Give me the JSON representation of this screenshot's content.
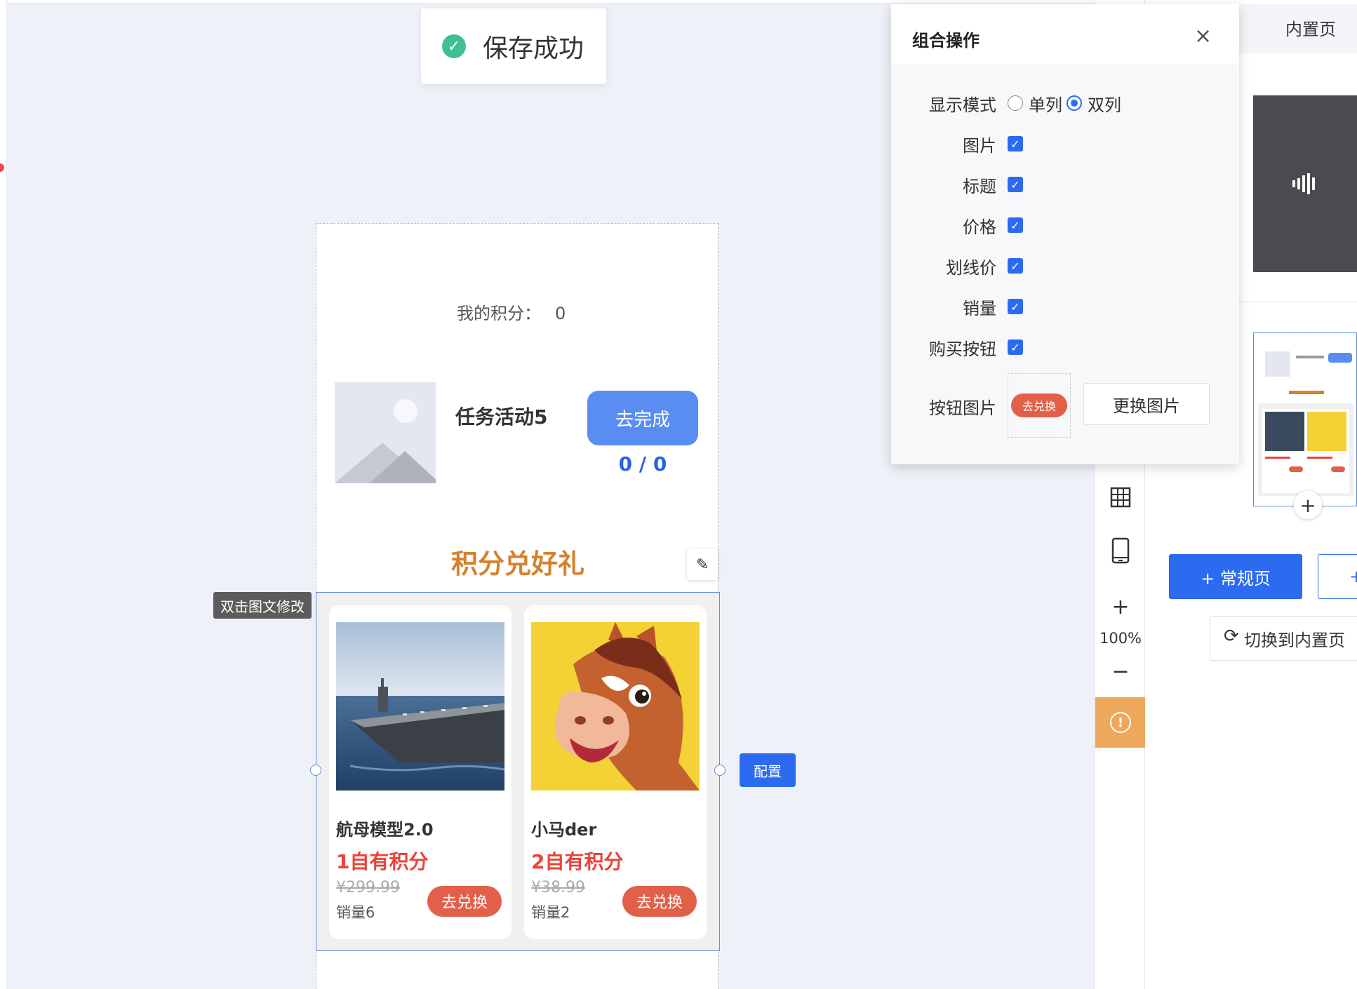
{
  "toast": {
    "icon": "check-circle-icon",
    "message": "保存成功"
  },
  "phone": {
    "points_label": "我的积分：",
    "points_value": "0",
    "task": {
      "title": "任务活动5",
      "button": "去完成",
      "progress": "0 / 0"
    },
    "section_title": "积分兑好礼",
    "hint": "双击图文修改",
    "products": [
      {
        "name": "航母模型2.0",
        "price": "1自有积分",
        "original_price": "¥299.99",
        "sales": "销量6",
        "button": "去兑换"
      },
      {
        "name": "小马der",
        "price": "2自有积分",
        "original_price": "¥38.99",
        "sales": "销量2",
        "button": "去兑换"
      }
    ]
  },
  "config_button": "配置",
  "toolbar": {
    "zoom": "100%",
    "plus": "+",
    "minus": "−"
  },
  "right_panel": {
    "tab": "内置页",
    "regular_page_button": "+ 常规页",
    "second_button": "+",
    "switch_button": "切换到内置页"
  },
  "modal": {
    "title": "组合操作",
    "close": "×",
    "display_mode_label": "显示模式",
    "modes": [
      {
        "label": "单列",
        "selected": false
      },
      {
        "label": "双列",
        "selected": true
      }
    ],
    "options": [
      {
        "label": "图片",
        "checked": true
      },
      {
        "label": "标题",
        "checked": true
      },
      {
        "label": "价格",
        "checked": true
      },
      {
        "label": "划线价",
        "checked": true
      },
      {
        "label": "销量",
        "checked": true
      },
      {
        "label": "购买按钮",
        "checked": true
      }
    ],
    "button_image_label": "按钮图片",
    "button_image_text": "去兑换",
    "change_image_button": "更换图片"
  },
  "colors": {
    "primary": "#2c6bf0",
    "accent_orange": "#d5822d",
    "price_red": "#e8453c",
    "buy_button": "#e2604a",
    "success": "#3fbf95"
  }
}
